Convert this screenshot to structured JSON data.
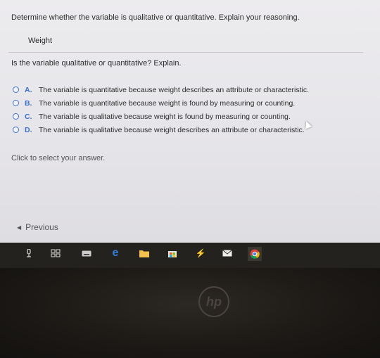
{
  "question": {
    "title": "Determine whether the variable is qualitative or quantitative. Explain your reasoning.",
    "variable": "Weight",
    "prompt": "Is the variable qualitative or quantitative? Explain."
  },
  "choices": [
    {
      "letter": "A.",
      "text": "The variable is quantitative because weight describes an attribute or characteristic."
    },
    {
      "letter": "B.",
      "text": "The variable is quantitative because weight is found by measuring or counting."
    },
    {
      "letter": "C.",
      "text": "The variable is qualitative because weight is found by measuring or counting."
    },
    {
      "letter": "D.",
      "text": "The variable is qualitative because weight describes an attribute or characteristic."
    }
  ],
  "instruction": "Click to select your answer.",
  "nav": {
    "previous_label": "Previous"
  },
  "taskbar": {
    "icons": [
      "search-icon",
      "task-view-icon",
      "keyboard-icon",
      "edge-icon",
      "file-explorer-icon",
      "store-icon",
      "visual-studio-icon",
      "mail-icon",
      "chrome-icon"
    ]
  },
  "colors": {
    "accent": "#3a6fd8",
    "text": "#2b2b2b",
    "taskbar": "#24221f"
  },
  "bezel": {
    "logo": "hp"
  }
}
